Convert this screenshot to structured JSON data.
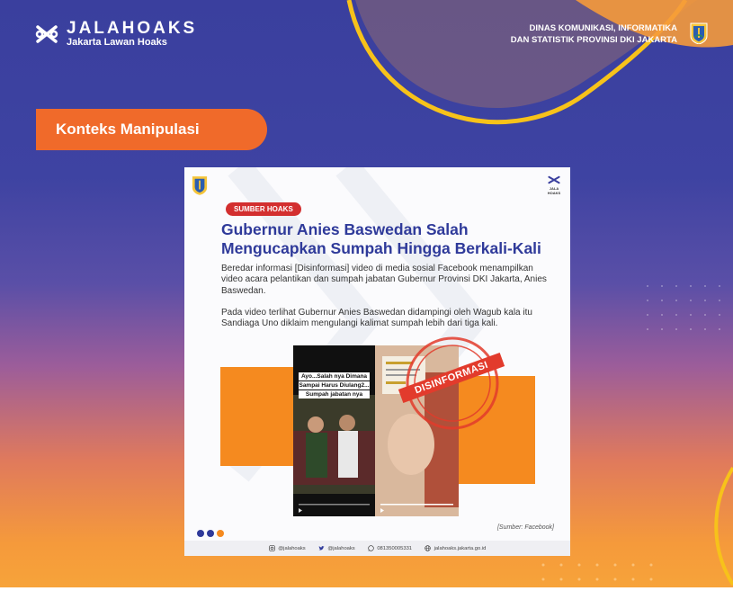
{
  "header": {
    "logo_title": "JALAHOAKS",
    "logo_subtitle": "Jakarta Lawan Hoaks",
    "agency_line1": "DINAS KOMUNIKASI, INFORMATIKA",
    "agency_line2": "DAN STATISTIK PROVINSI DKI JAKARTA"
  },
  "section_label": "Konteks Manipulasi",
  "card": {
    "badge": "SUMBER HOAKS",
    "headline_line1": "Gubernur Anies Baswedan Salah",
    "headline_line2": "Mengucapkan Sumpah Hingga Berkali-Kali",
    "paragraph1": "Beredar informasi [Disinformasi] video di media sosial Facebook menampilkan video acara pelantikan dan sumpah jabatan Gubernur Provinsi DKI Jakarta, Anies Baswedan.",
    "paragraph2": "Pada video terlihat Gubernur Anies Baswedan didampingi oleh Wagub kala itu Sandiaga Uno diklaim mengulangi kalimat sumpah lebih dari tiga kali.",
    "video_caption1": "Ayo...Salah nya Dimana",
    "video_caption2": "Sampai Harus Diulang2...",
    "video_caption3": "Sumpah jabatan nya",
    "stamp_label": "DISINFORMASI",
    "source": "[Sumber: Facebook]",
    "card_logo": "JALA HOAKS",
    "footer": {
      "instagram": "@jalahoaks",
      "twitter": "@jalahoaks",
      "whatsapp": "081350005331",
      "website": "jalahoaks.jakarta.go.id"
    }
  },
  "colors": {
    "navy": "#3a3f9e",
    "orange": "#f58a1f",
    "pill": "#f06a2a",
    "headline": "#2f3a9a",
    "badge": "#d32f2f",
    "stamp": "#e23b2c",
    "swoosh": "#f7c21a"
  },
  "icons": [
    "jalahoaks-logo-icon",
    "dki-emblem-icon",
    "instagram-icon",
    "twitter-icon",
    "whatsapp-icon",
    "globe-icon"
  ]
}
